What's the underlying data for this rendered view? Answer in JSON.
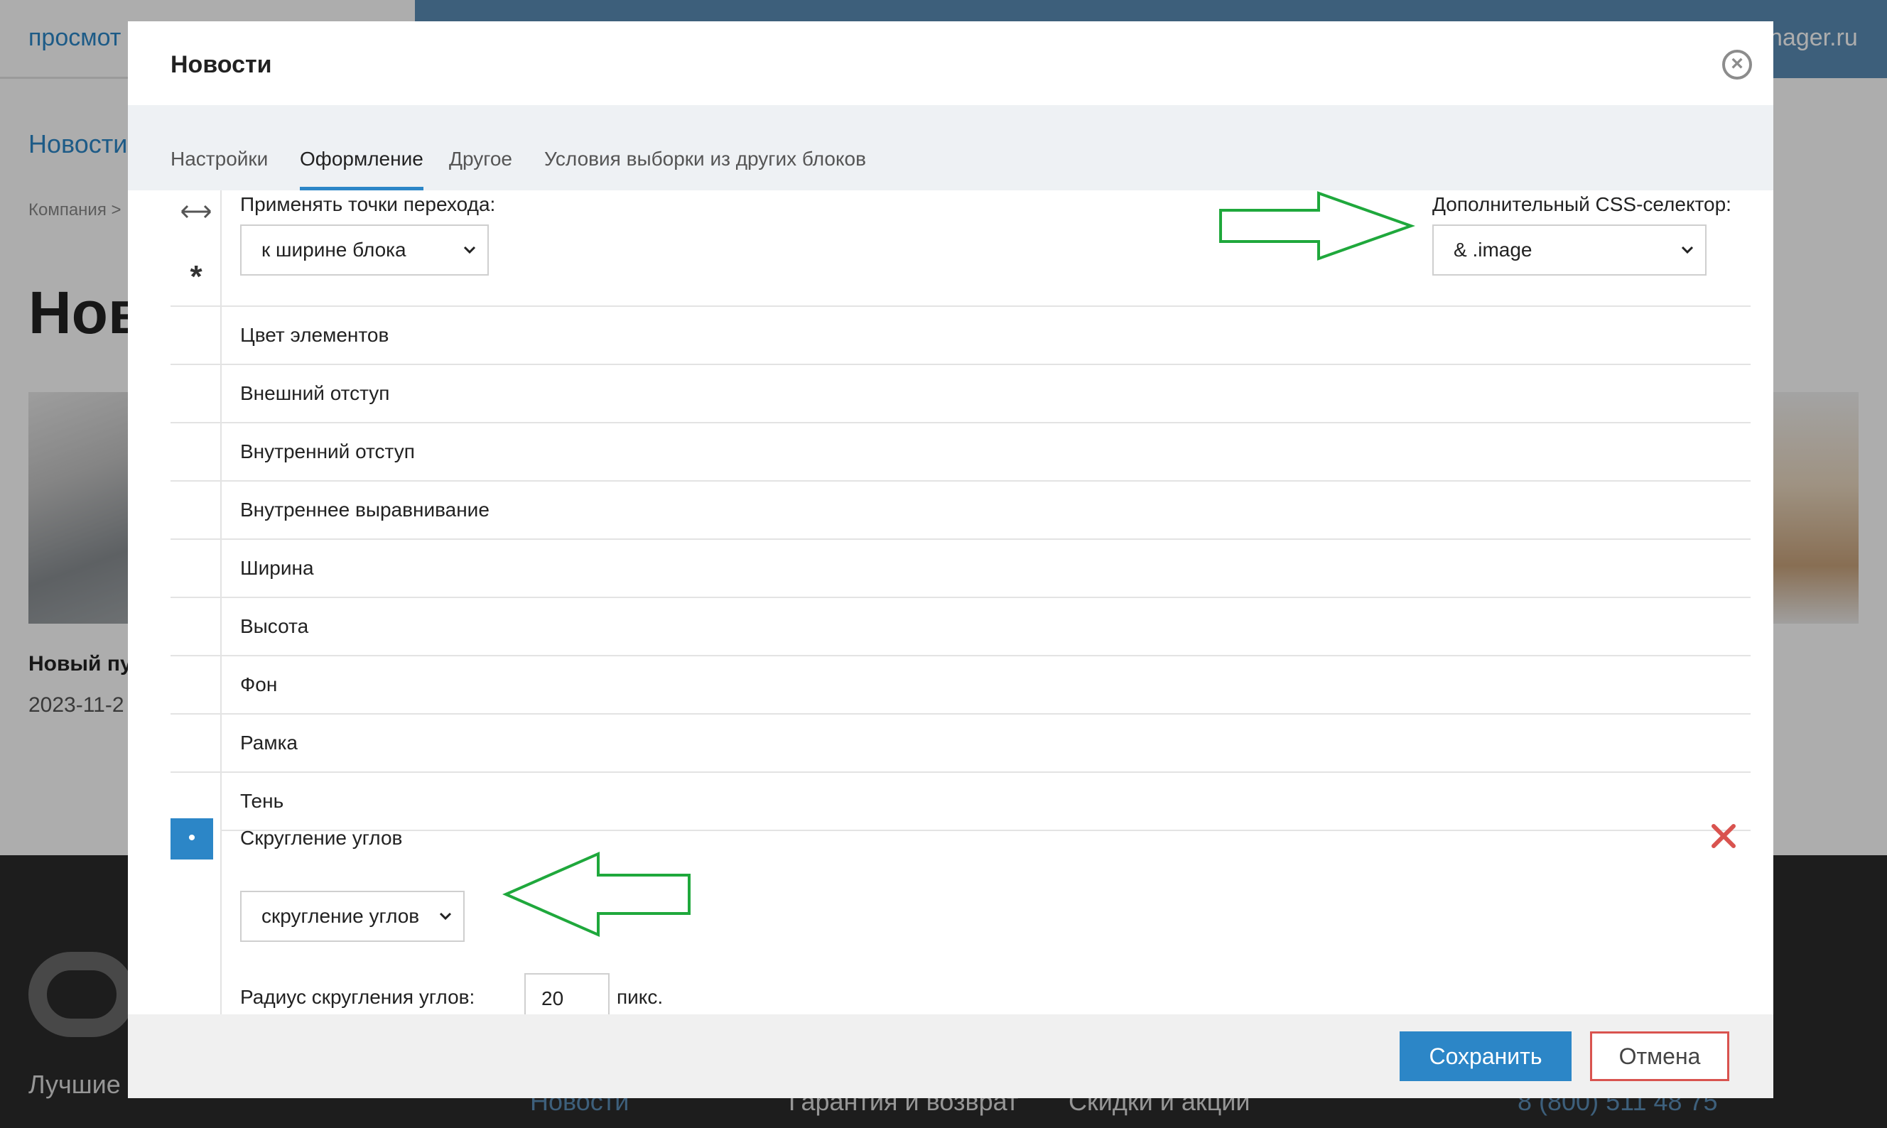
{
  "background": {
    "top_left_link": "просмот",
    "top_right_text": "nager.ru",
    "nav_news": "Новости",
    "breadcrumb": "Компания  >",
    "page_heading": "Нов",
    "news_title": "Новый пу",
    "news_date": "2023-11-2",
    "footer_tagline": "Лучшие",
    "footer_news": "Новости",
    "footer_warranty": "Гарантия и возврат",
    "footer_discounts": "Скидки и акции",
    "footer_phone": "8 (800) 511 48 75"
  },
  "modal": {
    "title": "Новости",
    "close_icon": "close-circle-icon",
    "tabs": [
      {
        "label": "Настройки",
        "active": false
      },
      {
        "label": "Оформление",
        "active": true
      },
      {
        "label": "Другое",
        "active": false
      },
      {
        "label": "Условия выборки из других блоков",
        "active": false
      }
    ],
    "breakpoints": {
      "label": "Применять точки перехода:",
      "value": "к ширине блока"
    },
    "css_selector": {
      "label": "Дополнительный CSS-селектор:",
      "value": "& .image"
    },
    "rail": {
      "arrows_icon": "left-right-arrows-icon",
      "star": "*",
      "active_marker": "•"
    },
    "properties": [
      "Цвет элементов",
      "Внешний отступ",
      "Внутренний отступ",
      "Внутреннее выравнивание",
      "Ширина",
      "Высота",
      "Фон",
      "Рамка",
      "Тень"
    ],
    "rounding": {
      "label": "Скругление углов",
      "select_value": "скругление углов",
      "radius_label": "Радиус скругления углов:",
      "radius_value": "20",
      "unit": "пикс.",
      "delete_icon": "delete-x-icon"
    },
    "footer": {
      "save_label": "Сохранить",
      "cancel_label": "Отмена"
    }
  },
  "colors": {
    "accent": "#2c86c7",
    "annotation_arrow": "#1fa83c",
    "delete": "#d9534f",
    "overlay": "rgba(0,0,0,0.32)"
  }
}
